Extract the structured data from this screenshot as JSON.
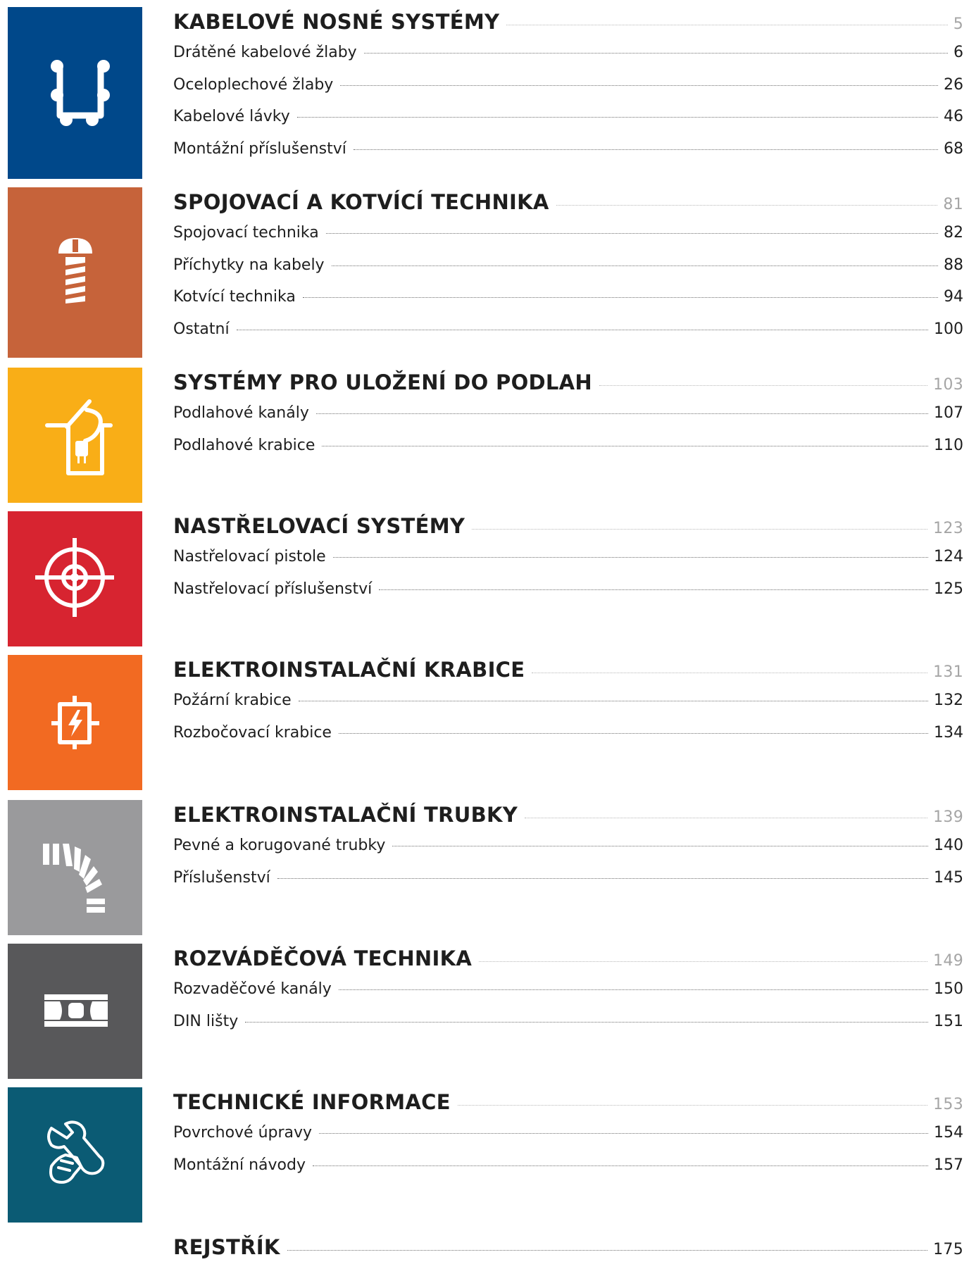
{
  "sections": [
    {
      "color": "#00488a",
      "icon": "cable-tray-icon",
      "title": "KABELOVÉ NOSNÉ SYSTÉMY",
      "page": "5",
      "items": [
        {
          "label": "Drátěné kabelové žlaby",
          "page": "6"
        },
        {
          "label": "Oceloplechové žlaby",
          "page": "26"
        },
        {
          "label": "Kabelové lávky",
          "page": "46"
        },
        {
          "label": "Montážní příslušenství",
          "page": "68"
        }
      ]
    },
    {
      "color": "#c6633a",
      "icon": "screw-icon",
      "title": "SPOJOVACÍ A KOTVÍCÍ TECHNIKA",
      "page": "81",
      "items": [
        {
          "label": "Spojovací technika",
          "page": "82"
        },
        {
          "label": "Příchytky na kabely",
          "page": "88"
        },
        {
          "label": "Kotvící technika",
          "page": "94"
        },
        {
          "label": "Ostatní",
          "page": "100"
        }
      ]
    },
    {
      "color": "#f9ae17",
      "icon": "floor-box-icon",
      "title": "SYSTÉMY PRO ULOŽENÍ DO PODLAH",
      "page": "103",
      "items": [
        {
          "label": "Podlahové kanály",
          "page": "107"
        },
        {
          "label": "Podlahové krabice",
          "page": "110"
        }
      ]
    },
    {
      "color": "#d72430",
      "icon": "target-icon",
      "title": "NASTŘELOVACÍ SYSTÉMY",
      "page": "123",
      "items": [
        {
          "label": "Nastřelovací pistole",
          "page": "124"
        },
        {
          "label": "Nastřelovací příslušenství",
          "page": "125"
        }
      ]
    },
    {
      "color": "#f26a22",
      "icon": "junction-box-icon",
      "title": "ELEKTROINSTALAČNÍ KRABICE",
      "page": "131",
      "items": [
        {
          "label": "Požární krabice",
          "page": "132"
        },
        {
          "label": "Rozbočovací krabice",
          "page": "134"
        }
      ]
    },
    {
      "color": "#9a9a9c",
      "icon": "conduit-pipe-icon",
      "title": "ELEKTROINSTALAČNÍ TRUBKY",
      "page": "139",
      "items": [
        {
          "label": "Pevné a korugované trubky",
          "page": "140"
        },
        {
          "label": "Příslušenství",
          "page": "145"
        }
      ]
    },
    {
      "color": "#58585a",
      "icon": "din-rail-icon",
      "title": "ROZVÁDĚČOVÁ TECHNIKA",
      "page": "149",
      "items": [
        {
          "label": "Rozvaděčové kanály",
          "page": "150"
        },
        {
          "label": "DIN lišty",
          "page": "151"
        }
      ]
    },
    {
      "color": "#0b5b74",
      "icon": "wrench-hand-icon",
      "title": "TECHNICKÉ INFORMACE",
      "page": "153",
      "items": [
        {
          "label": "Povrchové úpravy",
          "page": "154"
        },
        {
          "label": "Montážní návody",
          "page": "157"
        }
      ]
    }
  ],
  "index": {
    "title": "REJSTŘÍK",
    "page": "175"
  }
}
